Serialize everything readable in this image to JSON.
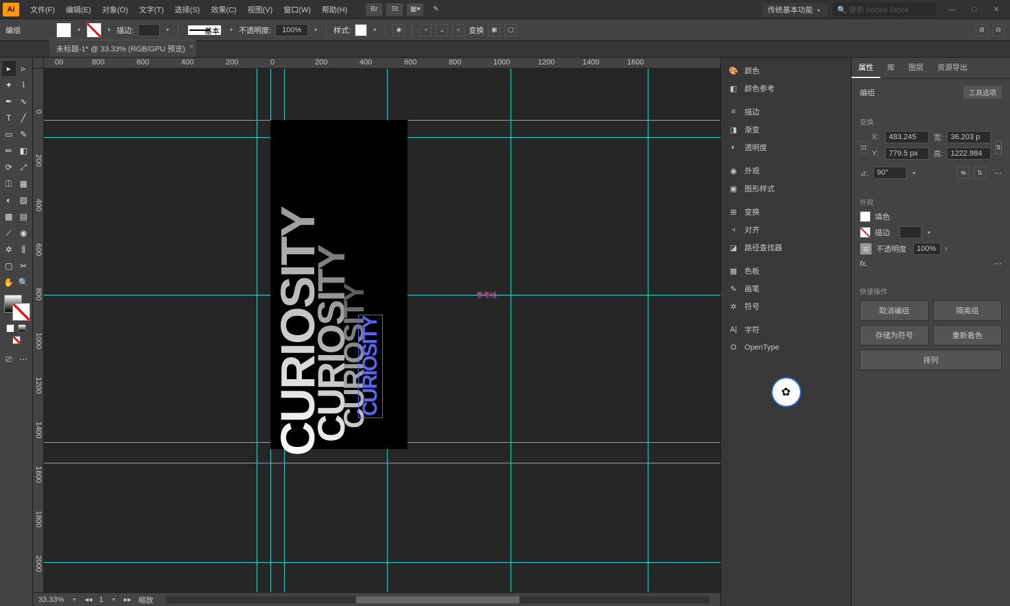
{
  "menubar": {
    "items": [
      "文件(F)",
      "编辑(E)",
      "对象(O)",
      "文字(T)",
      "选择(S)",
      "效果(C)",
      "视图(V)",
      "窗口(W)",
      "帮助(H)"
    ],
    "workspace": "传统基本功能",
    "search_placeholder": "搜索 Adobe Stock"
  },
  "optbar": {
    "label": "编组",
    "stroke_label": "描边:",
    "stroke_size": "",
    "profile_label": "基本",
    "opacity_label": "不透明度:",
    "opacity_value": "100%",
    "style_label": "样式:",
    "transform_btn": "变换"
  },
  "doc": {
    "tab": "未标题-1* @ 33.33% (RGB/GPU 预览)"
  },
  "ruler_h": [
    "00",
    "800",
    "600",
    "400",
    "200",
    "0",
    "200",
    "400",
    "600",
    "800",
    "1000",
    "1200",
    "1400",
    "1600"
  ],
  "ruler_v": [
    "0",
    "200",
    "400",
    "600",
    "800",
    "1000",
    "1200",
    "1400",
    "1600",
    "1800",
    "2000"
  ],
  "art_text": "CURIOSITY",
  "guide_label": "参考线",
  "status": {
    "zoom": "33.33%",
    "artboard": "1",
    "nav_label": "缩放"
  },
  "side_panels": {
    "g1": [
      "颜色",
      "颜色参考"
    ],
    "g2": [
      "描边",
      "渐变",
      "透明度"
    ],
    "g3": [
      "外观",
      "图形样式"
    ],
    "g4": [
      "变换",
      "对齐",
      "路径查找器"
    ],
    "g5": [
      "色板",
      "画笔",
      "符号"
    ],
    "g6": [
      "字符",
      "OpenType"
    ]
  },
  "props": {
    "tabs": [
      "属性",
      "库",
      "图层",
      "资源导出"
    ],
    "obj_type": "编组",
    "tool_opts": "工具选项",
    "sec_transform": "变换",
    "x_label": "X:",
    "x_val": "483.245",
    "w_label": "宽:",
    "w_val": "36.203 p",
    "y_label": "Y:",
    "y_val": "779.5 px",
    "h_label": "高:",
    "h_val": "1222.984",
    "rot_label": "⊿:",
    "rot_val": "90°",
    "sec_appearance": "外观",
    "fill_label": "填色",
    "stroke_label": "描边",
    "op_label": "不透明度",
    "op_val": "100%",
    "fx_label": "fx.",
    "sec_qa": "快速操作",
    "qa": [
      "取消编组",
      "隔离组",
      "存储为符号",
      "重新着色",
      "排列"
    ]
  }
}
